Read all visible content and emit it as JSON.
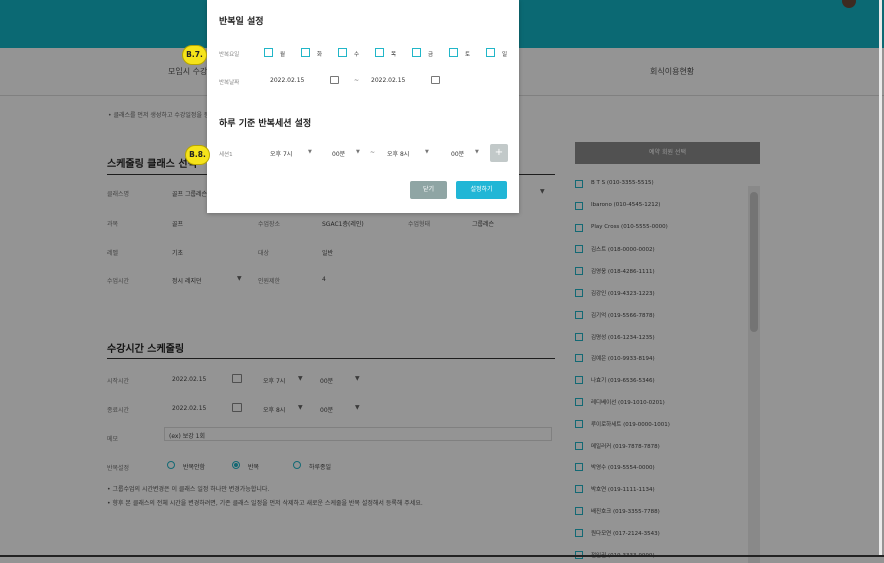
{
  "background": {
    "tabs": [
      "모임시 수강",
      "회식이용현황"
    ],
    "notice": "• 클래스를 먼저 생성하고 수강일정을 등록해 주세요.",
    "schedule_section": {
      "title": "스케줄링 클래스 선택",
      "rows": [
        {
          "label": "클래스명",
          "value": "골프 그룹레슨"
        },
        {
          "label": "과목",
          "value": "골프",
          "label2": "수업장소",
          "value2": "SGAC1층(레인)",
          "label3": "수업형태",
          "value3": "그룹레슨"
        },
        {
          "label": "레벨",
          "value": "기초",
          "label2": "대상",
          "value2": "일반"
        },
        {
          "label": "수업시간",
          "value": "정시 레지던",
          "label2": "인원제한",
          "value2": "4"
        }
      ]
    },
    "time_section": {
      "title": "수강시간 스케줄링",
      "start_label": "시작시간",
      "start_date": "2022.02.15",
      "start_hour": "오후 7시",
      "start_min": "00분",
      "end_label": "종료시간",
      "end_date": "2022.02.15",
      "end_hour": "오후 8시",
      "end_min": "00분",
      "memo_label": "메모",
      "memo_placeholder": "(ex) 보강 1회",
      "repeat_label": "반복설정",
      "repeat_options": [
        "반복안함",
        "반복",
        "하루종일"
      ],
      "repeat_selected": 1,
      "notes": [
        "• 그룹수업의 시간변경은 이 클래스 일정 하나만 변경가능합니다.",
        "• 향후 본 클래스의 전체 시간을 변경하려면, 기존 클래스 일정을 먼저 삭제하고 새로운 스케줄을 반복 설정해서 등록해 주세요."
      ]
    },
    "participants": {
      "header": "예약 회원 선택",
      "list": [
        "B T S (010-3355-5515)",
        "Ibarono (010-4545-1212)",
        "Play Cross (010-5555-0000)",
        "김스트 (018-0000-0002)",
        "김영웅 (018-4286-1111)",
        "김강인 (019-4323-1223)",
        "김기억 (019-5566-7878)",
        "김명성 (016-1234-1235)",
        "김예은 (010-9933-8194)",
        "나효기 (019-6536-5346)",
        "레디베이선 (019-1010-0201)",
        "루이로하세트 (019-0000-1001)",
        "메일러커 (019-7878-7878)",
        "박영수 (019-5554-0000)",
        "박호연 (019-1111-1134)",
        "배진호크 (019-3355-7788)",
        "원다모연 (017-2124-3543)",
        "전인권 (019-3333-9999)"
      ]
    }
  },
  "modal": {
    "title": "반복일 설정",
    "day_label": "반복요일",
    "days": [
      "월",
      "화",
      "수",
      "목",
      "금",
      "토",
      "일"
    ],
    "period_label": "반복날짜",
    "start_date": "2022.02.15",
    "end_date": "2022.02.15",
    "range_sep": "~",
    "session_title": "하루 기준 반복세션 설정",
    "session_label": "세션1",
    "session_start_hour": "오후 7시",
    "session_start_min": "00분",
    "session_end_hour": "오후 8시",
    "session_end_min": "00분",
    "add_label": "+",
    "close_label": "닫기",
    "apply_label": "설정하기"
  },
  "callouts": [
    "B.7.",
    "B.8."
  ],
  "colors": {
    "topbar": "#14b6c6",
    "accent": "#21b6d6",
    "close_button": "#8fa5a4",
    "callout": "#f5e31a"
  }
}
